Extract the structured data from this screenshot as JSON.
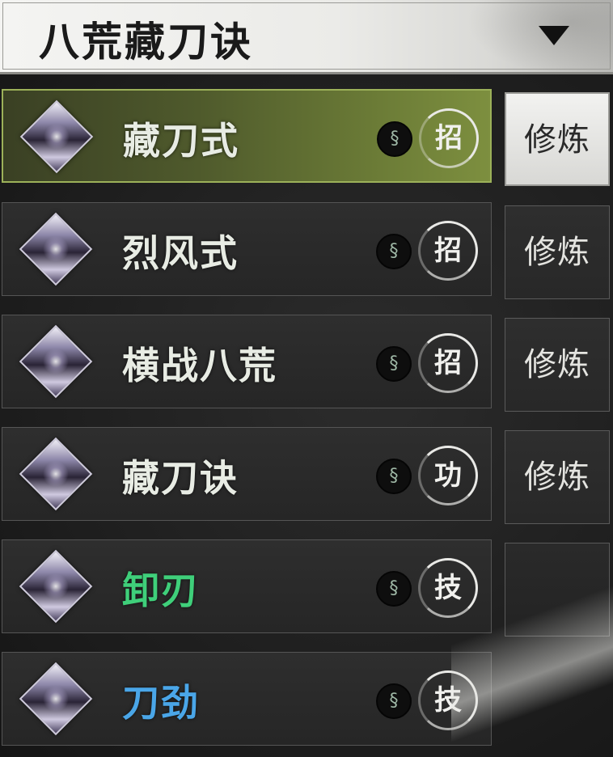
{
  "header": {
    "title": "八荒藏刀诀"
  },
  "skills": [
    {
      "name": "藏刀式",
      "type": "招",
      "train_label": "修炼",
      "name_color": "#e8ece4"
    },
    {
      "name": "烈风式",
      "type": "招",
      "train_label": "修炼",
      "name_color": "#e8ece4"
    },
    {
      "name": "横战八荒",
      "type": "招",
      "train_label": "修炼",
      "name_color": "#e8ece4"
    },
    {
      "name": "藏刀诀",
      "type": "功",
      "train_label": "修炼",
      "name_color": "#e8ece4"
    },
    {
      "name": "卸刃",
      "type": "技",
      "train_label": "",
      "name_color": "#3fcf7a"
    },
    {
      "name": "刀劲",
      "type": "技",
      "train_label": "",
      "name_color": "#4aa6e8"
    }
  ],
  "icons": {
    "token": "swirl-token-icon",
    "dropdown": "triangle-down-icon",
    "skill": "diamond-skill-icon"
  }
}
